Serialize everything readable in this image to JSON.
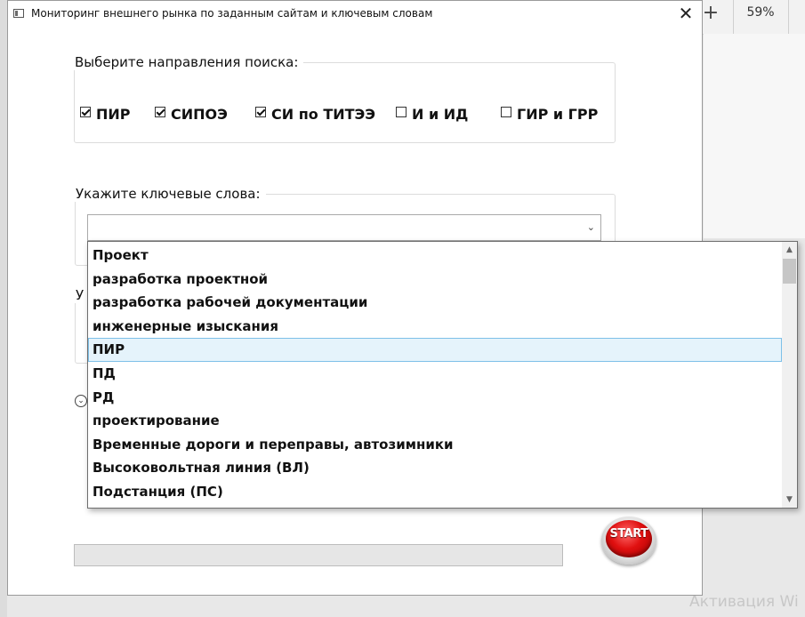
{
  "background": {
    "zoom_level": "59%",
    "plus_glyph": "+",
    "activation_text": "Активация Wi"
  },
  "window": {
    "title": "Мониторинг внешнего рынка по заданным сайтам и ключевым словам",
    "close_glyph": "✕"
  },
  "directions": {
    "legend": "Выберите направления поиска:",
    "items": [
      {
        "label": "ПИР",
        "checked": true
      },
      {
        "label": "СИПОЭ",
        "checked": true
      },
      {
        "label": "СИ по ТИТЭЭ",
        "checked": true
      },
      {
        "label": "И и ИД",
        "checked": false
      },
      {
        "label": "ГИР и ГРР",
        "checked": false
      }
    ]
  },
  "keywords": {
    "legend": "Укажите ключевые слова:",
    "value": "",
    "arrow_glyph": "⌄",
    "options": [
      "Проект",
      "разработка проектной",
      "разработка рабочей документации",
      "инженерные изыскания",
      "ПИР",
      "ПД",
      "РД",
      "проектирование",
      "Временные дороги и переправы, автозимники",
      "Высоковольтная линия (ВЛ)",
      "Подстанция (ПС)"
    ],
    "highlighted_index": 4
  },
  "third_group": {
    "legend_visible": "У"
  },
  "expander_glyph": "⌄",
  "progress": {
    "value": 0
  },
  "start_button": {
    "label": "START"
  }
}
